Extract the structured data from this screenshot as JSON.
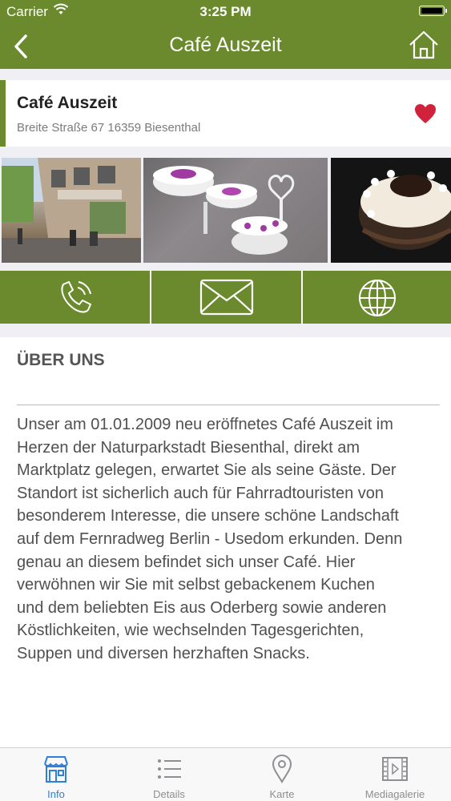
{
  "status_bar": {
    "carrier": "Carrier",
    "time": "3:25 PM"
  },
  "nav": {
    "title": "Café Auszeit",
    "back_icon": "chevron-left-icon",
    "home_icon": "home-icon"
  },
  "venue": {
    "name": "Café Auszeit",
    "address": "Breite Straße 67 16359 Biesenthal",
    "favorite_icon": "heart-icon"
  },
  "gallery": {
    "photos": [
      "cafe-exterior-photo",
      "cake-stand-photo",
      "chocolate-cake-photo"
    ]
  },
  "actions": {
    "call_icon": "phone-icon",
    "email_icon": "envelope-icon",
    "web_icon": "globe-icon"
  },
  "about": {
    "heading": "ÜBER UNS",
    "lines": [
      "Unser am 01.01.2009 neu eröffnetes Café Auszeit im",
      "Herzen der Naturparkstadt Biesenthal, direkt am",
      "Marktplatz gelegen, erwartet Sie als seine Gäste. Der",
      "Standort ist sicherlich auch für Fahrradtouristen von",
      "besonderem Interesse, die unsere schöne Landschaft",
      "auf dem Fernradweg Berlin - Usedom erkunden. Denn",
      "genau an diesem befindet sich unser Café. Hier",
      "verwöhnen wir Sie mit selbst gebackenem Kuchen",
      "und dem beliebten Eis aus Oderberg sowie anderen",
      "Köstlichkeiten, wie wechselnden Tagesgerichten,",
      "Suppen und diversen herzhaften Snacks."
    ]
  },
  "tabs": [
    {
      "label": "Info",
      "icon": "storefront-icon",
      "active": true
    },
    {
      "label": "Details",
      "icon": "list-icon",
      "active": false
    },
    {
      "label": "Karte",
      "icon": "map-pin-icon",
      "active": false
    },
    {
      "label": "Mediagalerie",
      "icon": "film-icon",
      "active": false
    }
  ],
  "colors": {
    "brand_green": "#6a8a2d",
    "heart_red": "#d0223a",
    "tab_active": "#2e7fd6",
    "tab_inactive": "#8e8e93"
  }
}
